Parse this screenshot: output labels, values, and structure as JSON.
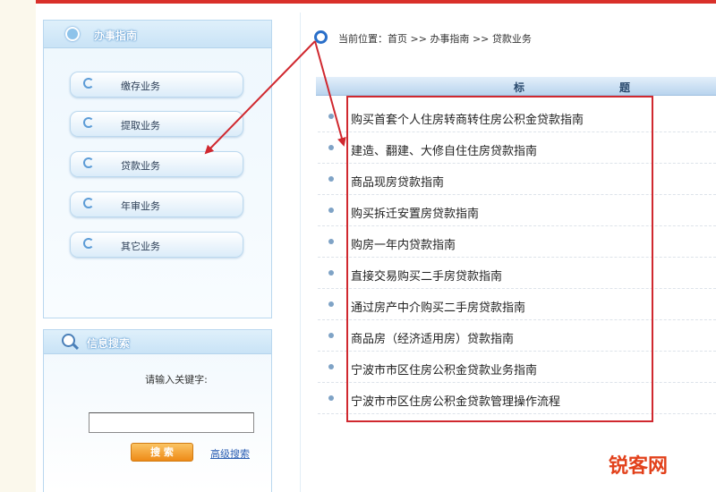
{
  "sidebar": {
    "guide_title": "办事指南",
    "menu": [
      {
        "label": "缴存业务"
      },
      {
        "label": "提取业务"
      },
      {
        "label": "贷款业务"
      },
      {
        "label": "年审业务"
      },
      {
        "label": "其它业务"
      }
    ],
    "search": {
      "title": "信息搜索",
      "prompt": "请输入关键字:",
      "input_value": "",
      "button": "搜 索",
      "advanced": "高级搜索"
    }
  },
  "breadcrumb": {
    "prefix": "当前位置：",
    "items": [
      "首页",
      "办事指南",
      "贷款业务"
    ],
    "sep": ">>"
  },
  "table": {
    "headers": [
      "标",
      "题"
    ],
    "rows": [
      {
        "title": "购买首套个人住房转商转住房公积金贷款指南"
      },
      {
        "title": "建造、翻建、大修自住住房贷款指南"
      },
      {
        "title": "商品现房贷款指南"
      },
      {
        "title": "购买拆迁安置房贷款指南"
      },
      {
        "title": "购房一年内贷款指南"
      },
      {
        "title": "直接交易购买二手房贷款指南"
      },
      {
        "title": "通过房产中介购买二手房贷款指南"
      },
      {
        "title": "商品房（经济适用房）贷款指南"
      },
      {
        "title": "宁波市市区住房公积金贷款业务指南"
      },
      {
        "title": "宁波市市区住房公积金贷款管理操作流程"
      }
    ]
  },
  "watermark": "锐客网",
  "colors": {
    "accent_blue": "#2a6fc9",
    "annotation_red": "#d0282f",
    "top_line": "#d9302a",
    "search_button": "#ee8a17"
  },
  "icons": {
    "guide": "guide-heart-icon",
    "menu_item": "circle-arrow-icon",
    "search": "magnifier-icon",
    "breadcrumb": "location-circle-icon",
    "row_bullet": "bullet-dot-icon"
  }
}
